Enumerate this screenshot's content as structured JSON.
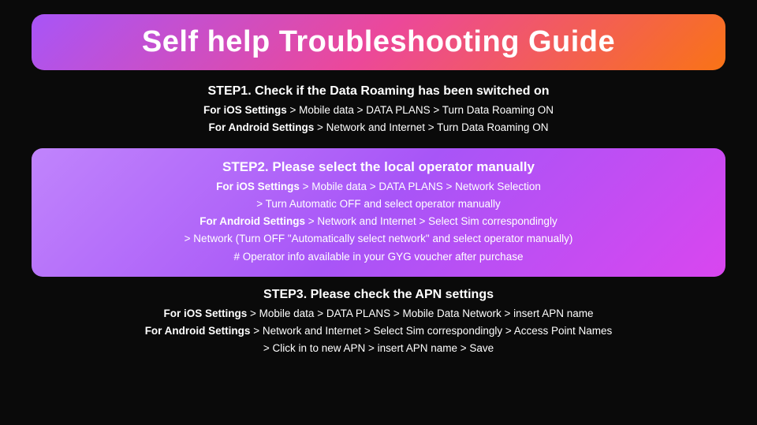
{
  "title": "Self help Troubleshooting Guide",
  "steps": [
    {
      "id": "step1",
      "highlighted": false,
      "title": "STEP1. Check if the Data Roaming has been switched on",
      "lines": [
        {
          "parts": [
            {
              "text": "For iOS Settings",
              "bold": true
            },
            {
              "text": " > Mobile data > DATA PLANS > Turn Data Roaming ON",
              "bold": false
            }
          ]
        },
        {
          "parts": [
            {
              "text": "For Android Settings",
              "bold": true
            },
            {
              "text": " > Network and Internet > Turn Data Roaming ON",
              "bold": false
            }
          ]
        }
      ]
    },
    {
      "id": "step2",
      "highlighted": true,
      "title": "STEP2. Please select the local operator manually",
      "lines": [
        {
          "parts": [
            {
              "text": "For iOS Settings",
              "bold": true
            },
            {
              "text": " > Mobile data > DATA PLANS > Network Selection",
              "bold": false
            }
          ]
        },
        {
          "parts": [
            {
              "text": "> Turn Automatic OFF and select operator manually",
              "bold": false
            }
          ]
        },
        {
          "parts": [
            {
              "text": "For Android Settings",
              "bold": true
            },
            {
              "text": " > Network and Internet > Select Sim correspondingly",
              "bold": false
            }
          ]
        },
        {
          "parts": [
            {
              "text": "> Network (Turn OFF \"Automatically select network\" and select operator manually)",
              "bold": false
            }
          ]
        },
        {
          "parts": [
            {
              "text": "# Operator info available in your GYG voucher after purchase",
              "bold": false
            }
          ]
        }
      ]
    },
    {
      "id": "step3",
      "highlighted": false,
      "title": "STEP3. Please check the APN settings",
      "lines": [
        {
          "parts": [
            {
              "text": "For iOS Settings",
              "bold": true
            },
            {
              "text": " > Mobile data > DATA PLANS > Mobile Data Network > insert APN name",
              "bold": false
            }
          ]
        },
        {
          "parts": [
            {
              "text": "For Android Settings",
              "bold": true
            },
            {
              "text": " > Network and Internet > Select Sim correspondingly > Access Point Names",
              "bold": false
            }
          ]
        },
        {
          "parts": [
            {
              "text": "> Click in to new APN > insert APN name > Save",
              "bold": false
            }
          ]
        }
      ]
    }
  ]
}
